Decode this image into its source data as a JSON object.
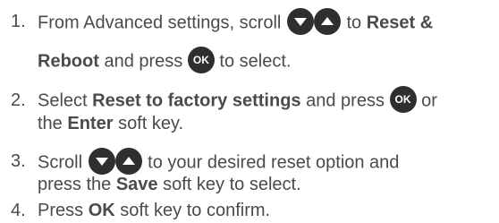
{
  "steps": [
    {
      "num": "1.",
      "l1a": "From Advanced settings, scroll",
      "l1b": "to",
      "l1c": "Reset &",
      "l2a": "Reboot",
      "l2b": "and press",
      "l2c": "to select."
    },
    {
      "num": "2.",
      "l1a": "Select",
      "l1b": "Reset to factory settings",
      "l1c": "and press",
      "l1d": "or",
      "l2a": "the",
      "l2b": "Enter",
      "l2c": "soft key."
    },
    {
      "num": "3.",
      "l1a": "Scroll",
      "l1b": "to your desired reset option and",
      "l2a": "press the",
      "l2b": "Save",
      "l2c": "soft key to select."
    },
    {
      "num": "4.",
      "l1a": "Press",
      "l1b": "OK",
      "l1c": "soft key to confirm."
    }
  ],
  "ok_key": "OK",
  "icons": {
    "down": "scroll-down-icon",
    "up": "scroll-up-icon",
    "ok": "ok-key-icon"
  },
  "colors": {
    "text": "#4a4a4a",
    "key": "#2f2f2f"
  }
}
